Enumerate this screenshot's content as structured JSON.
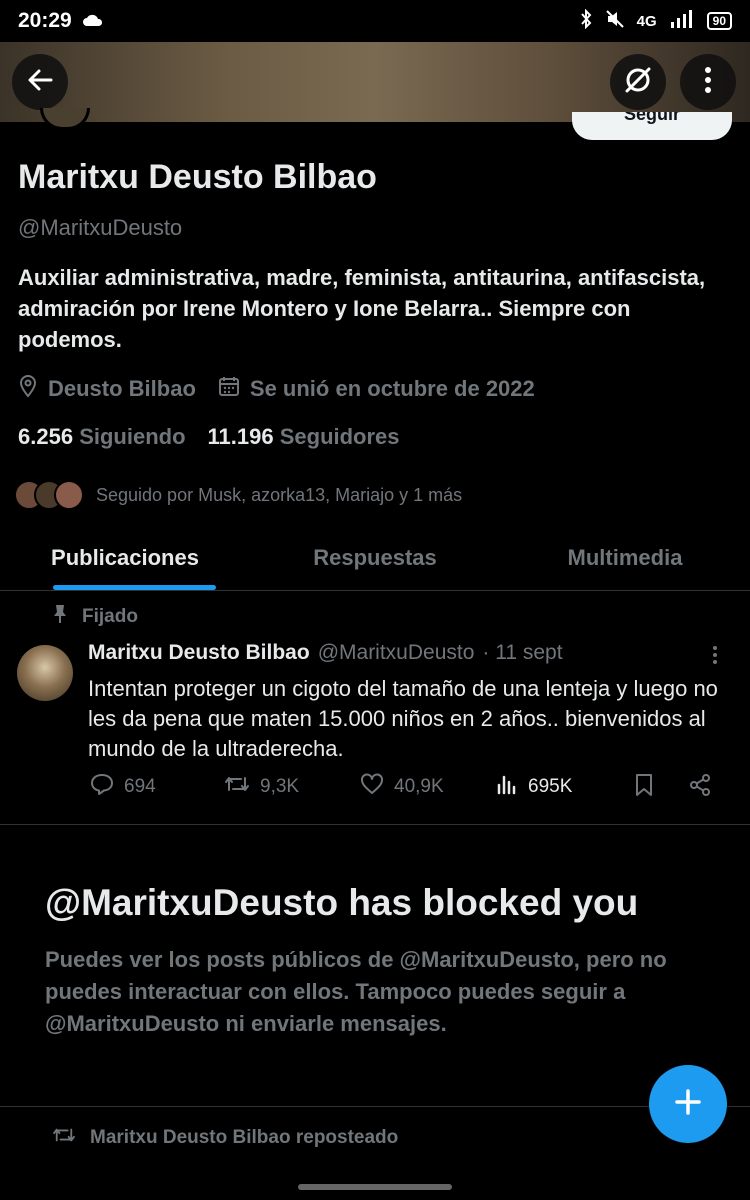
{
  "status_bar": {
    "time": "20:29",
    "network": "4G",
    "battery": "90"
  },
  "profile": {
    "follow_label": "Seguir",
    "display_name": "Maritxu Deusto Bilbao",
    "handle": "@MaritxuDeusto",
    "bio": "Auxiliar administrativa, madre, feminista, antitaurina, antifascista, admiración por Irene Montero y Ione Belarra.. Siempre con podemos.",
    "location": "Deusto Bilbao",
    "joined": "Se unió en octubre de 2022",
    "following_count": "6.256",
    "following_label": "Siguiendo",
    "followers_count": "11.196",
    "followers_label": "Seguidores",
    "followed_by": "Seguido por Musk, azorka13, Mariajo y 1 más"
  },
  "tabs": [
    {
      "label": "Publicaciones",
      "active": true
    },
    {
      "label": "Respuestas",
      "active": false
    },
    {
      "label": "Multimedia",
      "active": false
    }
  ],
  "pinned_tweet": {
    "pinned_label": "Fijado",
    "author_name": "Maritxu Deusto Bilbao",
    "author_handle": "@MaritxuDeusto",
    "date": "· 11 sept",
    "text": "Intentan proteger un cigoto del tamaño de una lenteja y luego no les da pena que maten 15.000 niños en 2 años.. bienvenidos al mundo de la ultraderecha.",
    "replies": "694",
    "reposts": "9,3K",
    "likes": "40,9K",
    "views": "695K"
  },
  "blocked": {
    "title": "@MaritxuDeusto has blocked you",
    "description": "Puedes ver los posts públicos de @MaritxuDeusto, pero no puedes interactuar con ellos. Tampoco puedes seguir a @MaritxuDeusto ni enviarle mensajes."
  },
  "next_item": {
    "repost_label": "Maritxu Deusto Bilbao reposteado"
  },
  "colors": {
    "accent": "#1d9bf0",
    "muted": "#71767b",
    "text": "#e7e9ea",
    "background": "#000000"
  }
}
